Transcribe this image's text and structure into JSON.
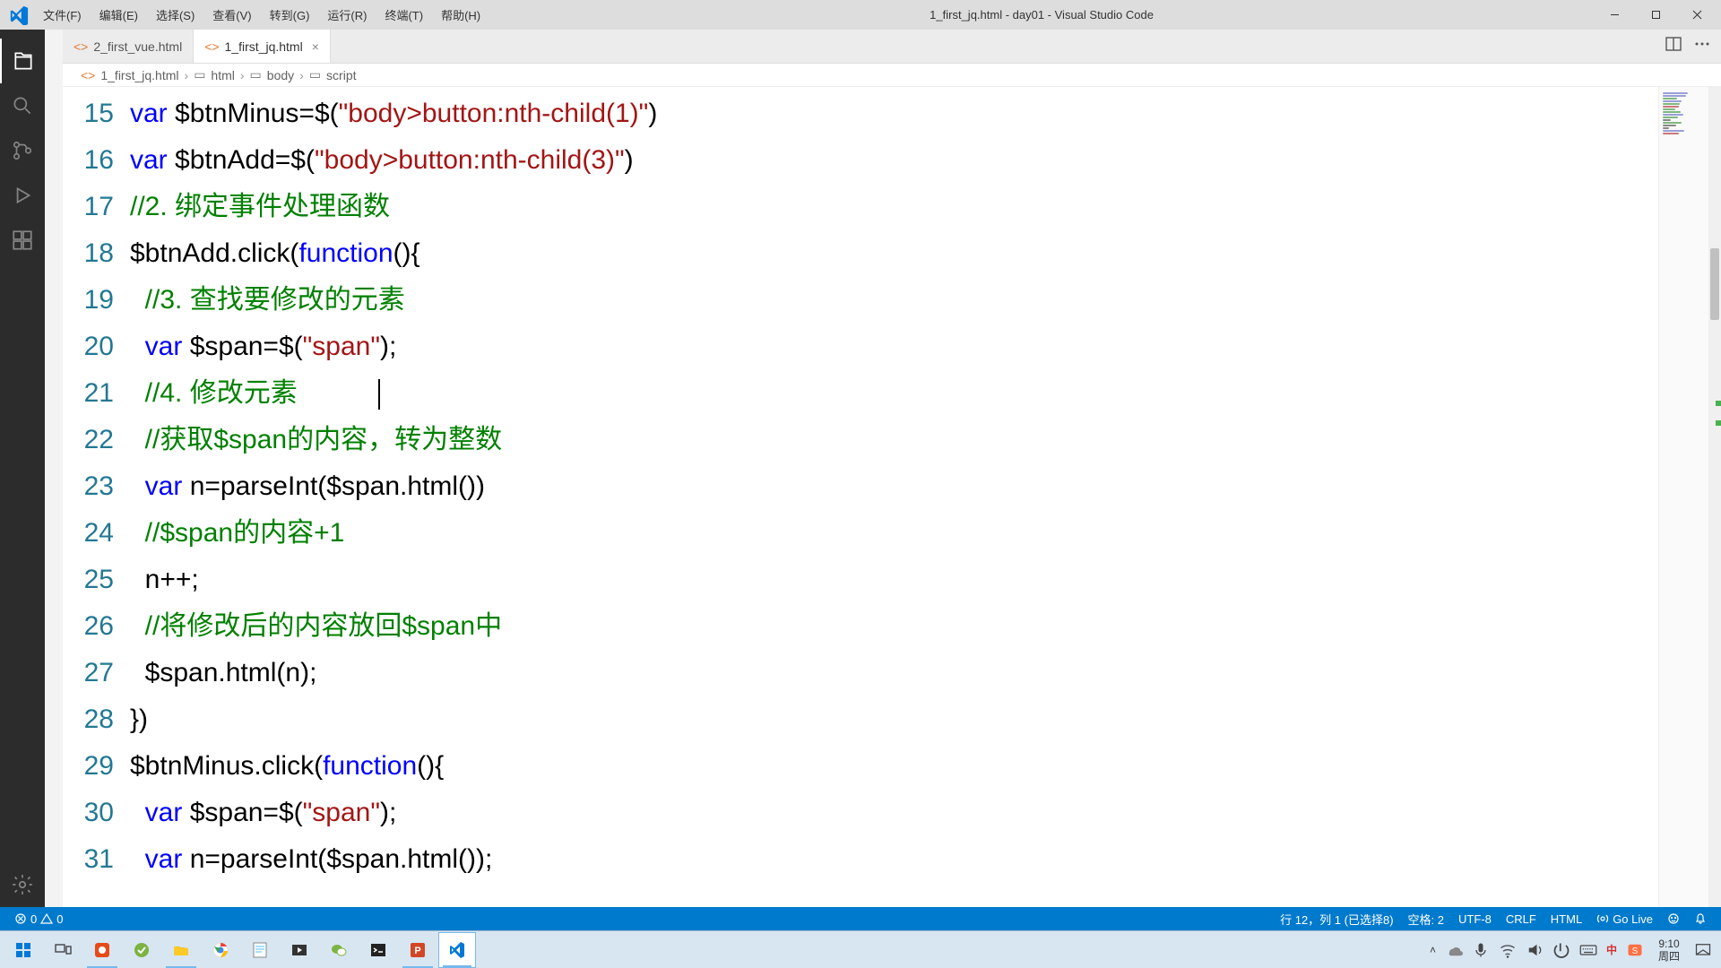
{
  "window": {
    "title": "1_first_jq.html - day01 - Visual Studio Code"
  },
  "menu": {
    "file": "文件(F)",
    "edit": "编辑(E)",
    "select": "选择(S)",
    "view": "查看(V)",
    "goto": "转到(G)",
    "run": "运行(R)",
    "terminal": "终端(T)",
    "help": "帮助(H)"
  },
  "tabs": {
    "t0": {
      "label": "2_first_vue.html"
    },
    "t1": {
      "label": "1_first_jq.html"
    }
  },
  "breadcrumbs": {
    "b0": "1_first_jq.html",
    "b1": "html",
    "b2": "body",
    "b3": "script"
  },
  "gutter": {
    "start": 15,
    "lines": [
      "15",
      "16",
      "17",
      "18",
      "19",
      "20",
      "21",
      "22",
      "23",
      "24",
      "25",
      "26",
      "27",
      "28",
      "29",
      "30",
      "31"
    ]
  },
  "code": {
    "l15a": "var",
    "l15b": " $btnMinus=$(",
    "l15c": "\"body>button:nth-child(1)\"",
    "l15d": ")",
    "l16a": "var",
    "l16b": " $btnAdd=$(",
    "l16c": "\"body>button:nth-child(3)\"",
    "l16d": ")",
    "l17": "//2. 绑定事件处理函数",
    "l18a": "$btnAdd.click(",
    "l18b": "function",
    "l18c": "(){",
    "l19": "  //3. 查找要修改的元素",
    "l20a": "  ",
    "l20b": "var",
    "l20c": " $span=$(",
    "l20d": "\"span\"",
    "l20e": ");",
    "l21": "  //4. 修改元素",
    "l22": "  //获取$span的内容，转为整数",
    "l23a": "  ",
    "l23b": "var",
    "l23c": " n=parseInt($span.html())",
    "l24": "  //$span的内容+1",
    "l25": "  n++;",
    "l26": "  //将修改后的内容放回$span中",
    "l27": "  $span.html(n);",
    "l28": "})",
    "l29a": "$btnMinus.click(",
    "l29b": "function",
    "l29c": "(){",
    "l30a": "  ",
    "l30b": "var",
    "l30c": " $span=$(",
    "l30d": "\"span\"",
    "l30e": ");",
    "l31a": "  ",
    "l31b": "var",
    "l31c": " n=parseInt($span.html());"
  },
  "status": {
    "errors": "0",
    "warnings": "0",
    "position": "行 12，列 1 (已选择8)",
    "spaces": "空格: 2",
    "encoding": "UTF-8",
    "eol": "CRLF",
    "lang": "HTML",
    "golive": "Go Live"
  },
  "tray": {
    "time": "9:10",
    "date": "周四"
  }
}
